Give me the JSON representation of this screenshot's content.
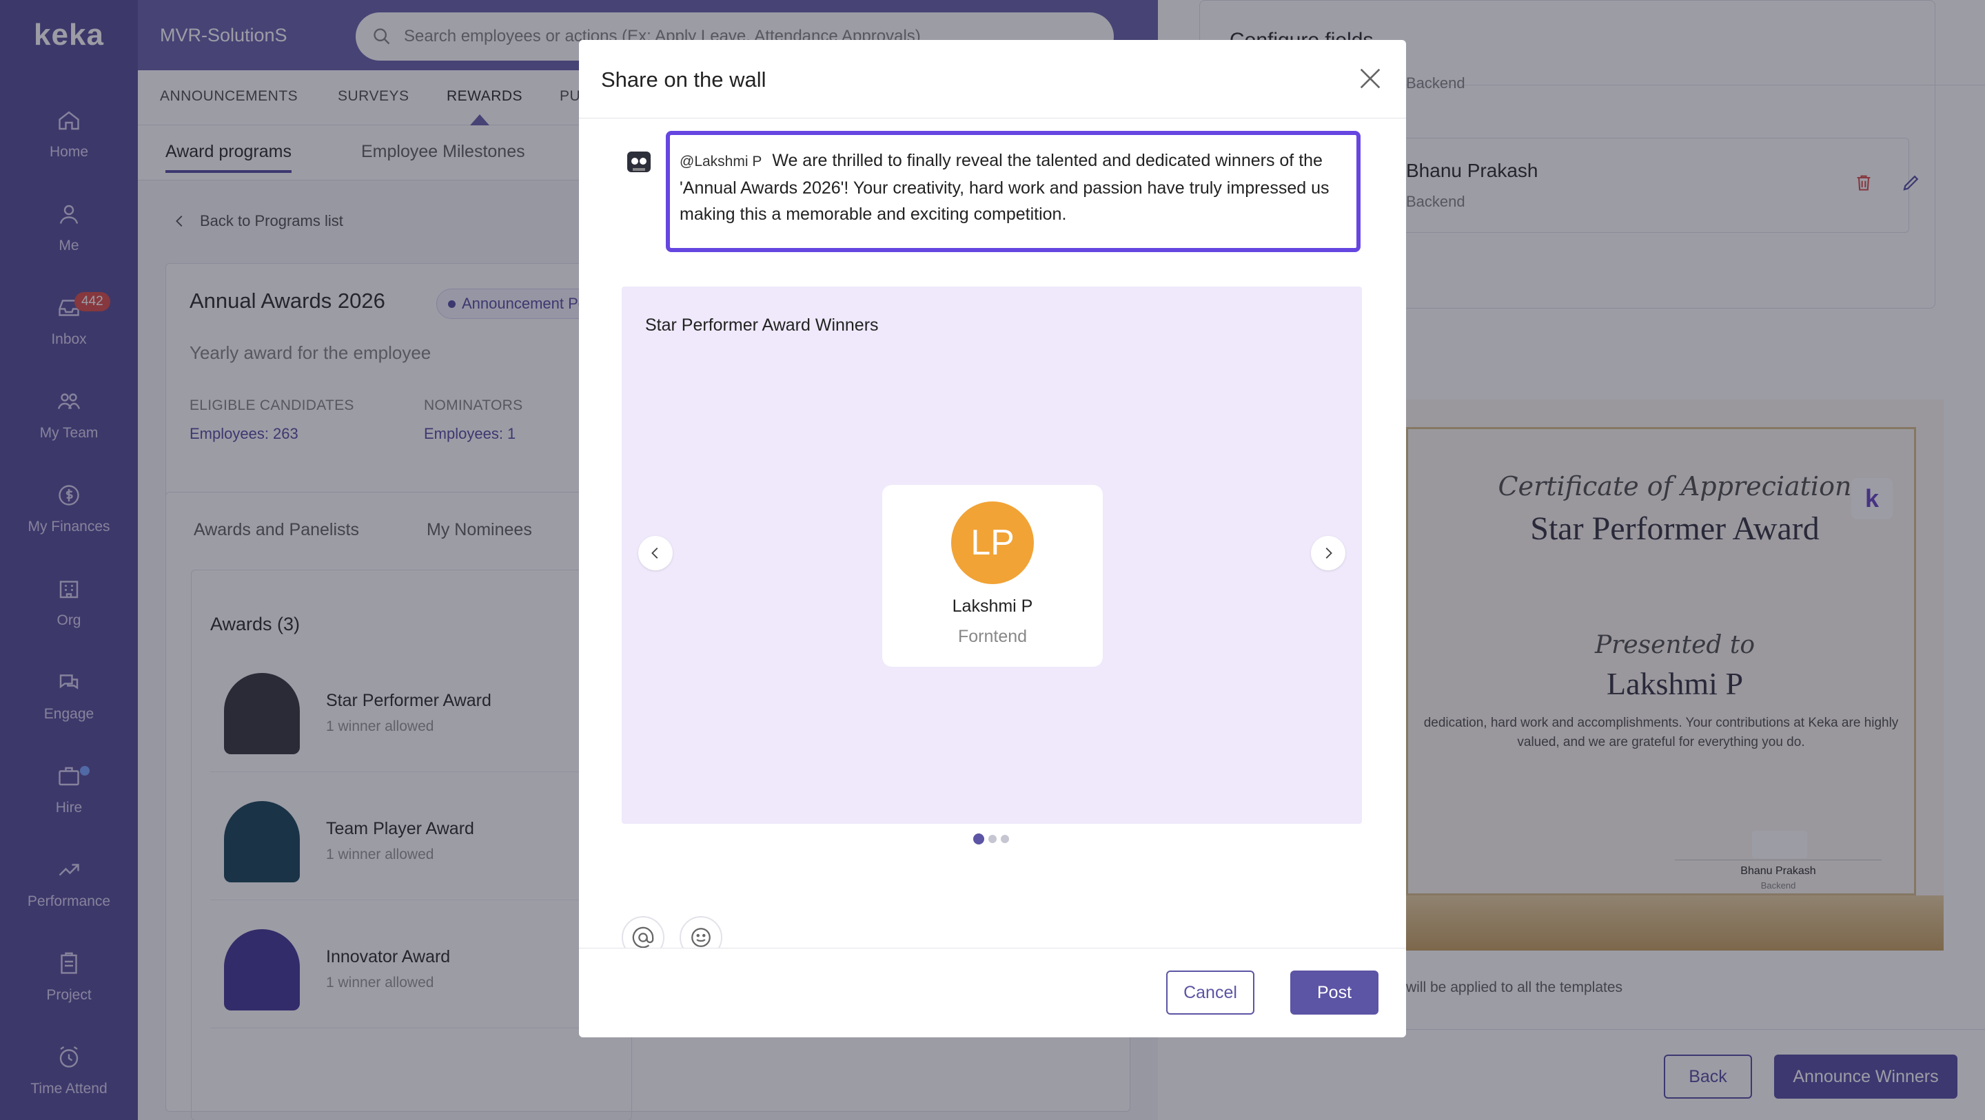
{
  "app": {
    "logo": "keka",
    "org_name": "MVR-SolutionS"
  },
  "search": {
    "placeholder": "Search employees or actions (Ex: Apply Leave, Attendance Approvals)"
  },
  "rail": {
    "items": [
      {
        "label": "Home",
        "icon": "home-icon"
      },
      {
        "label": "Me",
        "icon": "user-icon"
      },
      {
        "label": "Inbox",
        "icon": "inbox-icon",
        "badge": "442"
      },
      {
        "label": "My Team",
        "icon": "team-icon"
      },
      {
        "label": "My Finances",
        "icon": "finance-icon"
      },
      {
        "label": "Org",
        "icon": "org-icon"
      },
      {
        "label": "Engage",
        "icon": "engage-icon"
      },
      {
        "label": "Hire",
        "icon": "hire-icon"
      },
      {
        "label": "Performance",
        "icon": "performance-icon"
      },
      {
        "label": "Project",
        "icon": "project-icon"
      },
      {
        "label": "Time Attend",
        "icon": "clock-icon"
      }
    ]
  },
  "main": {
    "tabs": [
      "ANNOUNCEMENTS",
      "SURVEYS",
      "REWARDS",
      "PU"
    ],
    "subtabs": [
      "Award programs",
      "Employee Milestones"
    ],
    "back_link": "Back to Programs list",
    "program": {
      "title": "Annual Awards 2026",
      "status": "Announcement Pe",
      "description": "Yearly award for the employee",
      "eligible_label": "ELIGIBLE CANDIDATES",
      "eligible_value": "Employees: 263",
      "nominators_label": "NOMINATORS",
      "nominators_value": "Employees: 1"
    },
    "award_tabs": [
      "Awards and Panelists",
      "My Nominees"
    ],
    "awards_heading": "Awards (3)",
    "awards": [
      {
        "name": "Star Performer Award",
        "sub": "1 winner allowed",
        "color": "#3d3d44"
      },
      {
        "name": "Team Player Award",
        "sub": "1 winner allowed",
        "color": "#1f4a5e"
      },
      {
        "name": "Innovator Award",
        "sub": "1 winner allowed",
        "color": "#4a3f99"
      }
    ]
  },
  "drawer": {
    "title": "Configure fields",
    "top_role": "Backend",
    "panelist_name": "Bhanu Prakash",
    "panelist_role": "Backend",
    "certificate": {
      "heading": "Certificate of Appreciation",
      "award": "Star Performer Award",
      "presented_to": "Presented to",
      "recipient": "Lakshmi P",
      "body": "dedication, hard work and accomplishments. Your contributions at Keka are highly valued, and we are grateful for everything you do.",
      "signer_name": "Bhanu Prakash",
      "signer_role": "Backend",
      "logo": "k"
    },
    "note": "will be applied to all the templates",
    "back_label": "Back",
    "announce_label": "Announce Winners"
  },
  "modal": {
    "title": "Share on the wall",
    "mention": "@Lakshmi P",
    "message": "We are thrilled to finally reveal the talented and dedicated winners of the 'Annual Awards 2026'! Your creativity, hard work and passion have truly impressed us making this a memorable and exciting competition.",
    "slide_title": "Star Performer Award Winners",
    "winner": {
      "initials": "LP",
      "name": "Lakshmi P",
      "department": "Forntend"
    },
    "slides_total": 3,
    "slide_current": 1,
    "cancel_label": "Cancel",
    "post_label": "Post",
    "accent": "#5c54a4"
  }
}
